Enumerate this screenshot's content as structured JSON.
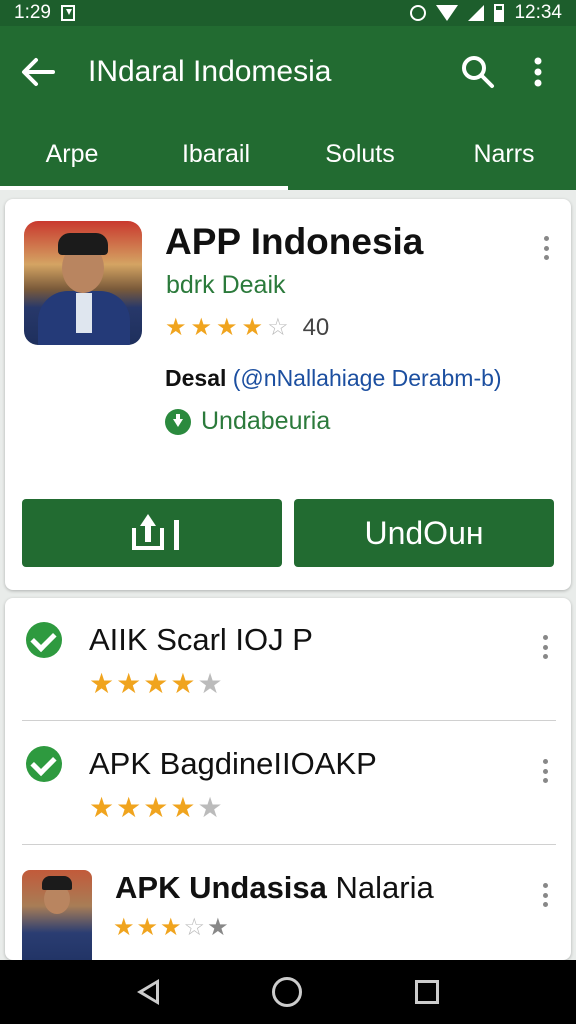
{
  "status_bar": {
    "time_left": "1:29",
    "time_right": "12:34"
  },
  "app_bar": {
    "title": "INdaral Indomesia",
    "back_icon": "arrow-left-icon",
    "search_icon": "search-icon",
    "menu_icon": "more-vert-icon"
  },
  "tabs": [
    {
      "label": "Arpe"
    },
    {
      "label": "Ibarail"
    },
    {
      "label": "Soluts"
    },
    {
      "label": "Narrs"
    }
  ],
  "featured": {
    "title": "APP Indonesia",
    "developer": "bdrk Deaik",
    "rating": 4,
    "rating_max": 5,
    "rating_count": "40",
    "desc_bold": "Desal",
    "desc_link": "(@nNallahiage Derabm-b)",
    "status": "Undabeuria",
    "primary_button": "UndOuн",
    "colors": {
      "primary": "#226b31",
      "star": "#f0a41e",
      "link": "#1c4fa0"
    }
  },
  "list": {
    "items": [
      {
        "title": "AIIK Scarl IOJ P",
        "rating": 4,
        "rating_max": 5,
        "installed": true
      },
      {
        "title": "APK BagdineIIOAKP",
        "rating": 4,
        "rating_max": 5,
        "installed": true
      },
      {
        "title_bold": "APK Undasisa",
        "title_regular": "Nalaria",
        "rating": 3,
        "rating_max": 5,
        "installed": false
      }
    ]
  }
}
